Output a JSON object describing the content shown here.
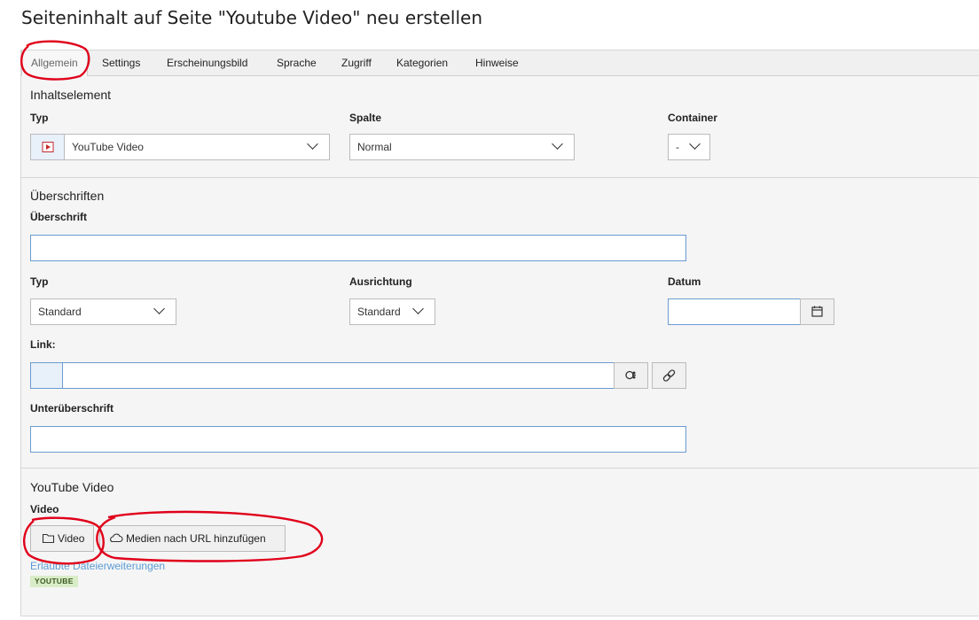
{
  "page_title": "Seiteninhalt auf Seite \"Youtube Video\" neu erstellen",
  "tabs": [
    {
      "label": "Allgemein"
    },
    {
      "label": "Settings"
    },
    {
      "label": "Erscheinungsbild"
    },
    {
      "label": "Sprache"
    },
    {
      "label": "Zugriff"
    },
    {
      "label": "Kategorien"
    },
    {
      "label": "Hinweise"
    }
  ],
  "content_element": {
    "section_title": "Inhaltselement",
    "typ_label": "Typ",
    "typ_value": "YouTube Video",
    "spalte_label": "Spalte",
    "spalte_value": "Normal",
    "container_label": "Container",
    "container_value": "-"
  },
  "headers": {
    "section_title": "Überschriften",
    "ueberschrift_label": "Überschrift",
    "ueberschrift_value": "",
    "typ_label": "Typ",
    "typ_value": "Standard",
    "ausrichtung_label": "Ausrichtung",
    "ausrichtung_value": "Standard",
    "datum_label": "Datum",
    "datum_value": "",
    "link_label": "Link:",
    "link_value": "",
    "unterueberschrift_label": "Unterüberschrift",
    "unterueberschrift_value": ""
  },
  "youtube": {
    "section_title": "YouTube Video",
    "video_label": "Video",
    "video_button": "Video",
    "url_button": "Medien nach URL hinzufügen",
    "allowed_link": "Erlaubte Dateierweiterungen",
    "allowed_badge": "YOUTUBE"
  },
  "colors": {
    "annotation": "#e0001a",
    "input_border": "#6b9bd1",
    "link": "#5b9bd5",
    "badge_bg": "#d9ecc8"
  }
}
